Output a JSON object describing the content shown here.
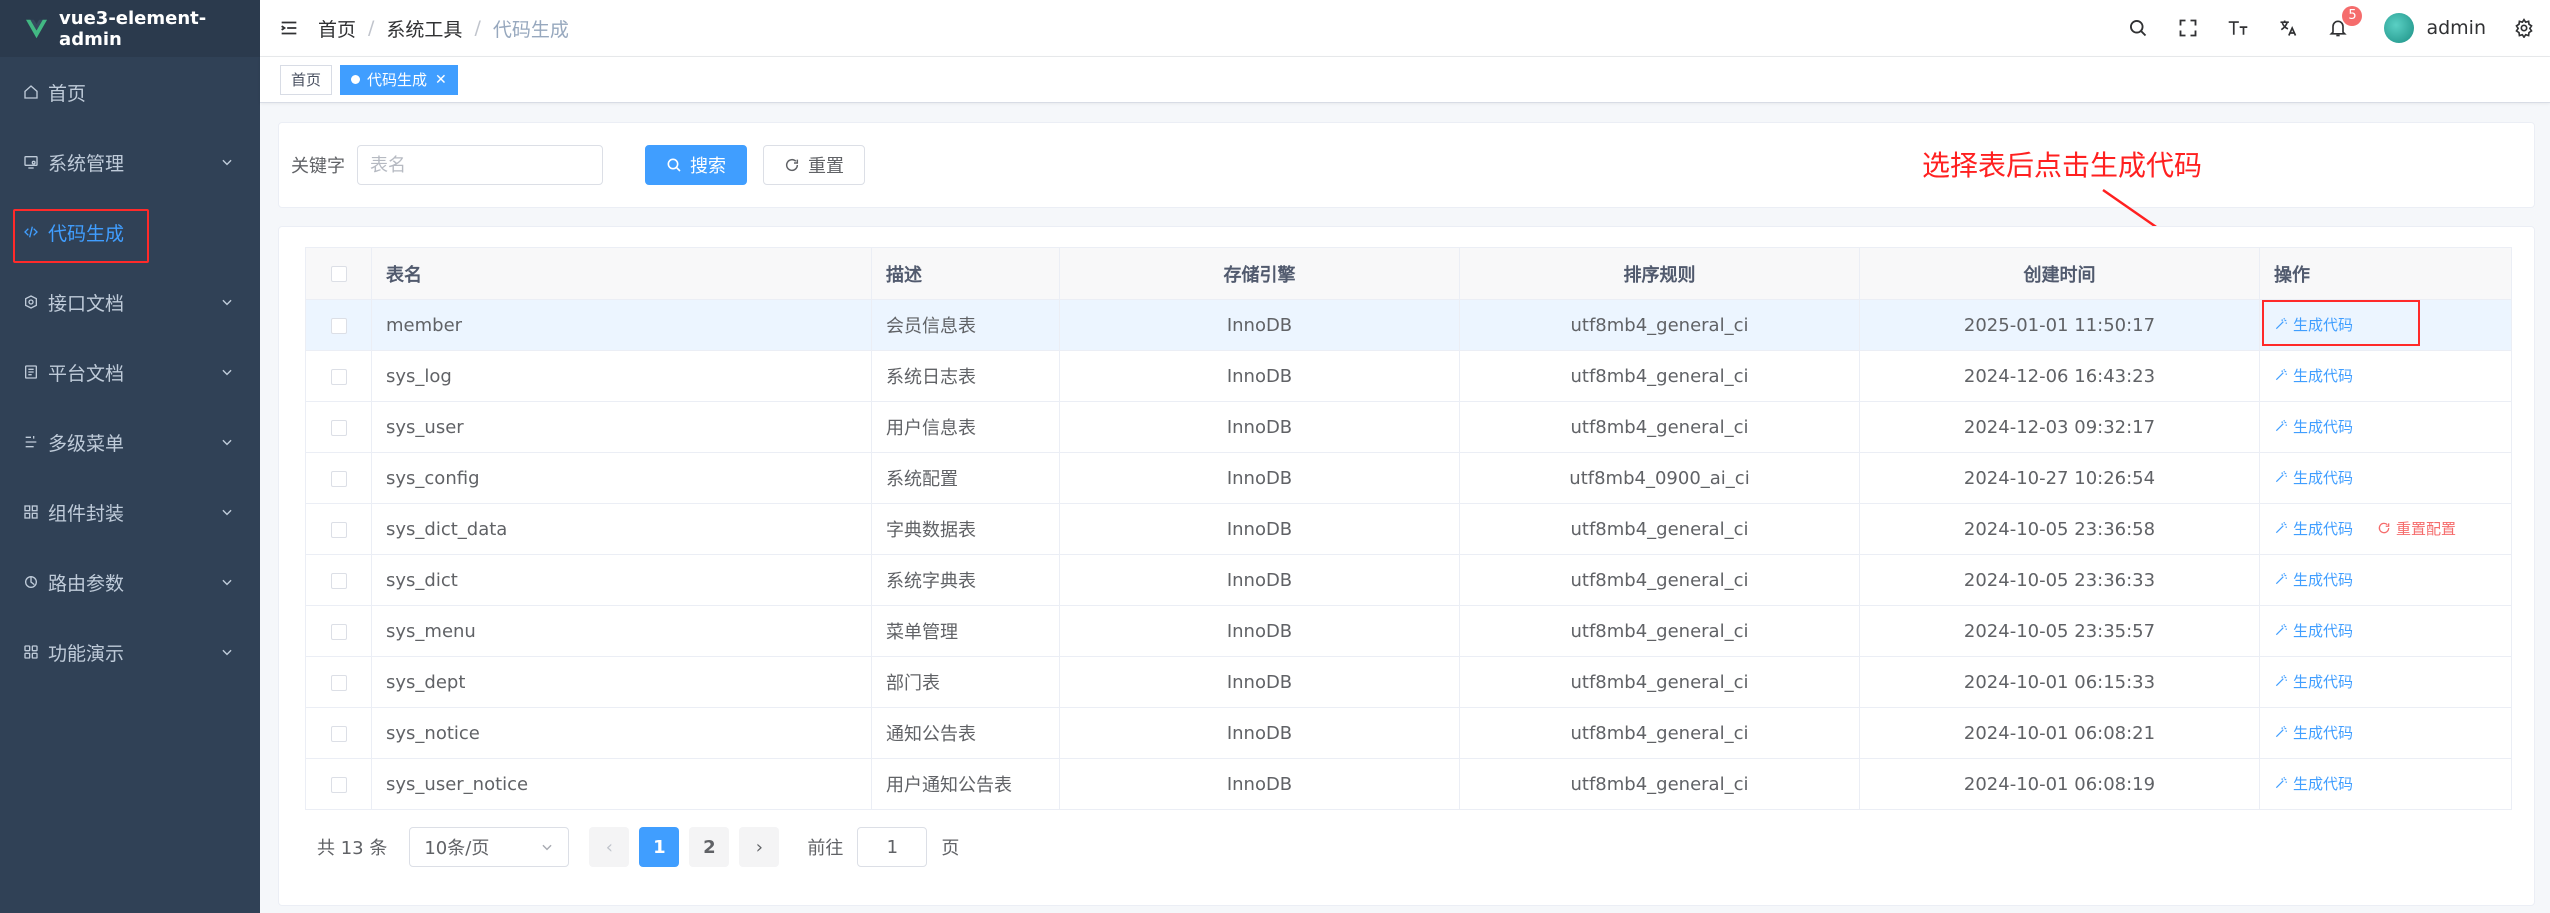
{
  "app": {
    "title": "vue3-element-admin"
  },
  "sidebar": {
    "items": [
      {
        "label": "首页",
        "icon": "home-icon",
        "has_children": false
      },
      {
        "label": "系统管理",
        "icon": "system-icon",
        "has_children": true
      },
      {
        "label": "代码生成",
        "icon": "code-icon",
        "has_children": false,
        "active": true
      },
      {
        "label": "接口文档",
        "icon": "api-icon",
        "has_children": true
      },
      {
        "label": "平台文档",
        "icon": "document-icon",
        "has_children": true
      },
      {
        "label": "多级菜单",
        "icon": "multi-menu-icon",
        "has_children": true
      },
      {
        "label": "组件封装",
        "icon": "component-icon",
        "has_children": true
      },
      {
        "label": "路由参数",
        "icon": "route-icon",
        "has_children": true
      },
      {
        "label": "功能演示",
        "icon": "demo-icon",
        "has_children": true
      }
    ]
  },
  "header": {
    "breadcrumb": [
      "首页",
      "系统工具",
      "代码生成"
    ],
    "notification_count": "5",
    "user_name": "admin"
  },
  "tags": [
    {
      "label": "首页",
      "active": false
    },
    {
      "label": "代码生成",
      "active": true
    }
  ],
  "search": {
    "keyword_label": "关键字",
    "placeholder": "表名",
    "search_label": "搜索",
    "reset_label": "重置"
  },
  "table": {
    "columns": [
      "表名",
      "描述",
      "存储引擎",
      "排序规则",
      "创建时间",
      "操作"
    ],
    "generate_label": "生成代码",
    "reset_config_label": "重置配置",
    "rows": [
      {
        "name": "member",
        "desc": "会员信息表",
        "engine": "InnoDB",
        "collation": "utf8mb4_general_ci",
        "created": "2025-01-01 11:50:17",
        "reset": false
      },
      {
        "name": "sys_log",
        "desc": "系统日志表",
        "engine": "InnoDB",
        "collation": "utf8mb4_general_ci",
        "created": "2024-12-06 16:43:23",
        "reset": false
      },
      {
        "name": "sys_user",
        "desc": "用户信息表",
        "engine": "InnoDB",
        "collation": "utf8mb4_general_ci",
        "created": "2024-12-03 09:32:17",
        "reset": false
      },
      {
        "name": "sys_config",
        "desc": "系统配置",
        "engine": "InnoDB",
        "collation": "utf8mb4_0900_ai_ci",
        "created": "2024-10-27 10:26:54",
        "reset": false
      },
      {
        "name": "sys_dict_data",
        "desc": "字典数据表",
        "engine": "InnoDB",
        "collation": "utf8mb4_general_ci",
        "created": "2024-10-05 23:36:58",
        "reset": true
      },
      {
        "name": "sys_dict",
        "desc": "系统字典表",
        "engine": "InnoDB",
        "collation": "utf8mb4_general_ci",
        "created": "2024-10-05 23:36:33",
        "reset": false
      },
      {
        "name": "sys_menu",
        "desc": "菜单管理",
        "engine": "InnoDB",
        "collation": "utf8mb4_general_ci",
        "created": "2024-10-05 23:35:57",
        "reset": false
      },
      {
        "name": "sys_dept",
        "desc": "部门表",
        "engine": "InnoDB",
        "collation": "utf8mb4_general_ci",
        "created": "2024-10-01 06:15:33",
        "reset": false
      },
      {
        "name": "sys_notice",
        "desc": "通知公告表",
        "engine": "InnoDB",
        "collation": "utf8mb4_general_ci",
        "created": "2024-10-01 06:08:21",
        "reset": false
      },
      {
        "name": "sys_user_notice",
        "desc": "用户通知公告表",
        "engine": "InnoDB",
        "collation": "utf8mb4_general_ci",
        "created": "2024-10-01 06:08:19",
        "reset": false
      }
    ]
  },
  "pagination": {
    "total_text": "共 13 条",
    "page_size": "10条/页",
    "pages": [
      "1",
      "2"
    ],
    "current_page": "1",
    "goto_prefix": "前往",
    "goto_value": "1",
    "goto_suffix": "页"
  },
  "annotation": {
    "text": "选择表后点击生成代码",
    "color": "#ff2020"
  },
  "colors": {
    "primary": "#409eff",
    "sidebar_bg": "#304156",
    "danger": "#f56c6c",
    "highlight": "#ff2a2a"
  }
}
